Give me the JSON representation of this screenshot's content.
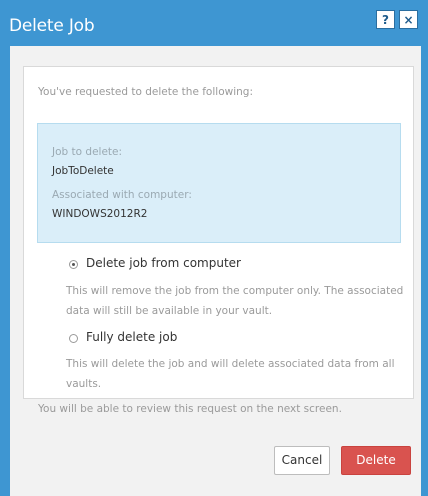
{
  "dialog": {
    "title": "Delete Job",
    "help_label": "?",
    "close_label": "×"
  },
  "intro": "You've requested to delete the following:",
  "info": {
    "job_label": "Job to delete:",
    "job_value": "JobToDelete",
    "computer_label": "Associated with computer:",
    "computer_value": "WINDOWS2012R2"
  },
  "options": [
    {
      "label": "Delete job from computer",
      "selected": true,
      "description": "This will remove the job from the computer only. The associated data will still be available in your vault."
    },
    {
      "label": "Fully delete job",
      "selected": false,
      "description": "This will delete the job and will delete associated data from all vaults."
    }
  ],
  "footnote": "You will be able to review this request on the next screen.",
  "buttons": {
    "cancel": "Cancel",
    "delete": "Delete"
  },
  "colors": {
    "header_blue": "#3e96d2",
    "info_box": "#daeef9",
    "delete_red": "#d9534f"
  }
}
